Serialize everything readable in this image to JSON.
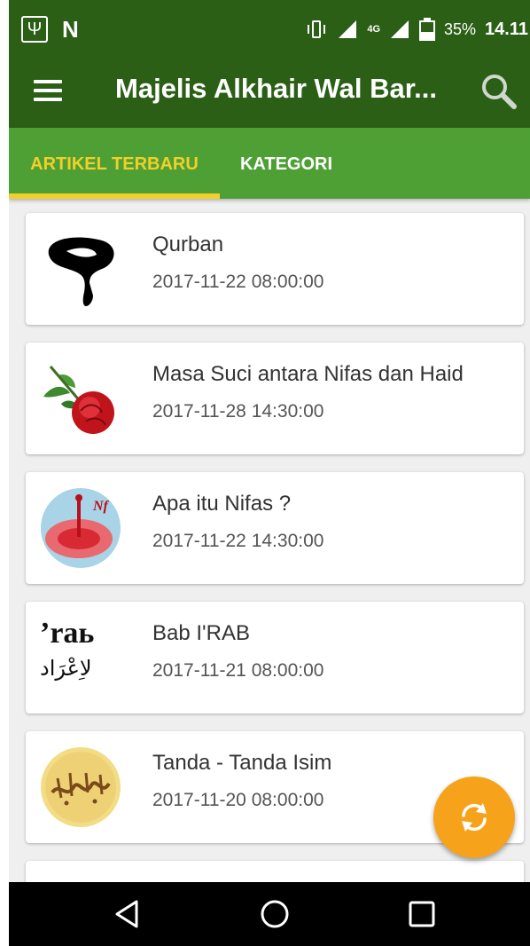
{
  "status_bar": {
    "battery": "35%",
    "time": "14.11",
    "network": "4G",
    "notification_letter": "N"
  },
  "app_bar": {
    "title": "Majelis Alkhair Wal Bar..."
  },
  "tabs": [
    {
      "label": "ARTIKEL TERBARU",
      "selected": true
    },
    {
      "label": "KATEGORI",
      "selected": false
    }
  ],
  "articles": [
    {
      "title": "Qurban",
      "date": "2017-11-22 08:00:00",
      "thumbnail": "question-silhouette-icon"
    },
    {
      "title": "Masa Suci antara Nifas dan Haid",
      "date": "2017-11-28 14:30:00",
      "thumbnail": "rose-icon"
    },
    {
      "title": "Apa itu Nifas ?",
      "date": "2017-11-22 14:30:00",
      "thumbnail": "blood-drop-icon"
    },
    {
      "title": "Bab I'RAB",
      "date": "2017-11-21 08:00:00",
      "thumbnail": "irab-text-icon"
    },
    {
      "title": "Tanda - Tanda Isim",
      "date": "2017-11-20 08:00:00",
      "thumbnail": "arabic-calligraphy-icon"
    }
  ],
  "thumb_text": {
    "irab_latin": "’raь",
    "irab_arabic": "لاِعْرَاد"
  },
  "colors": {
    "primary_dark": "#2b5f16",
    "primary": "#4ea035",
    "accent": "#f2cf2a",
    "fab": "#f7a21b"
  }
}
